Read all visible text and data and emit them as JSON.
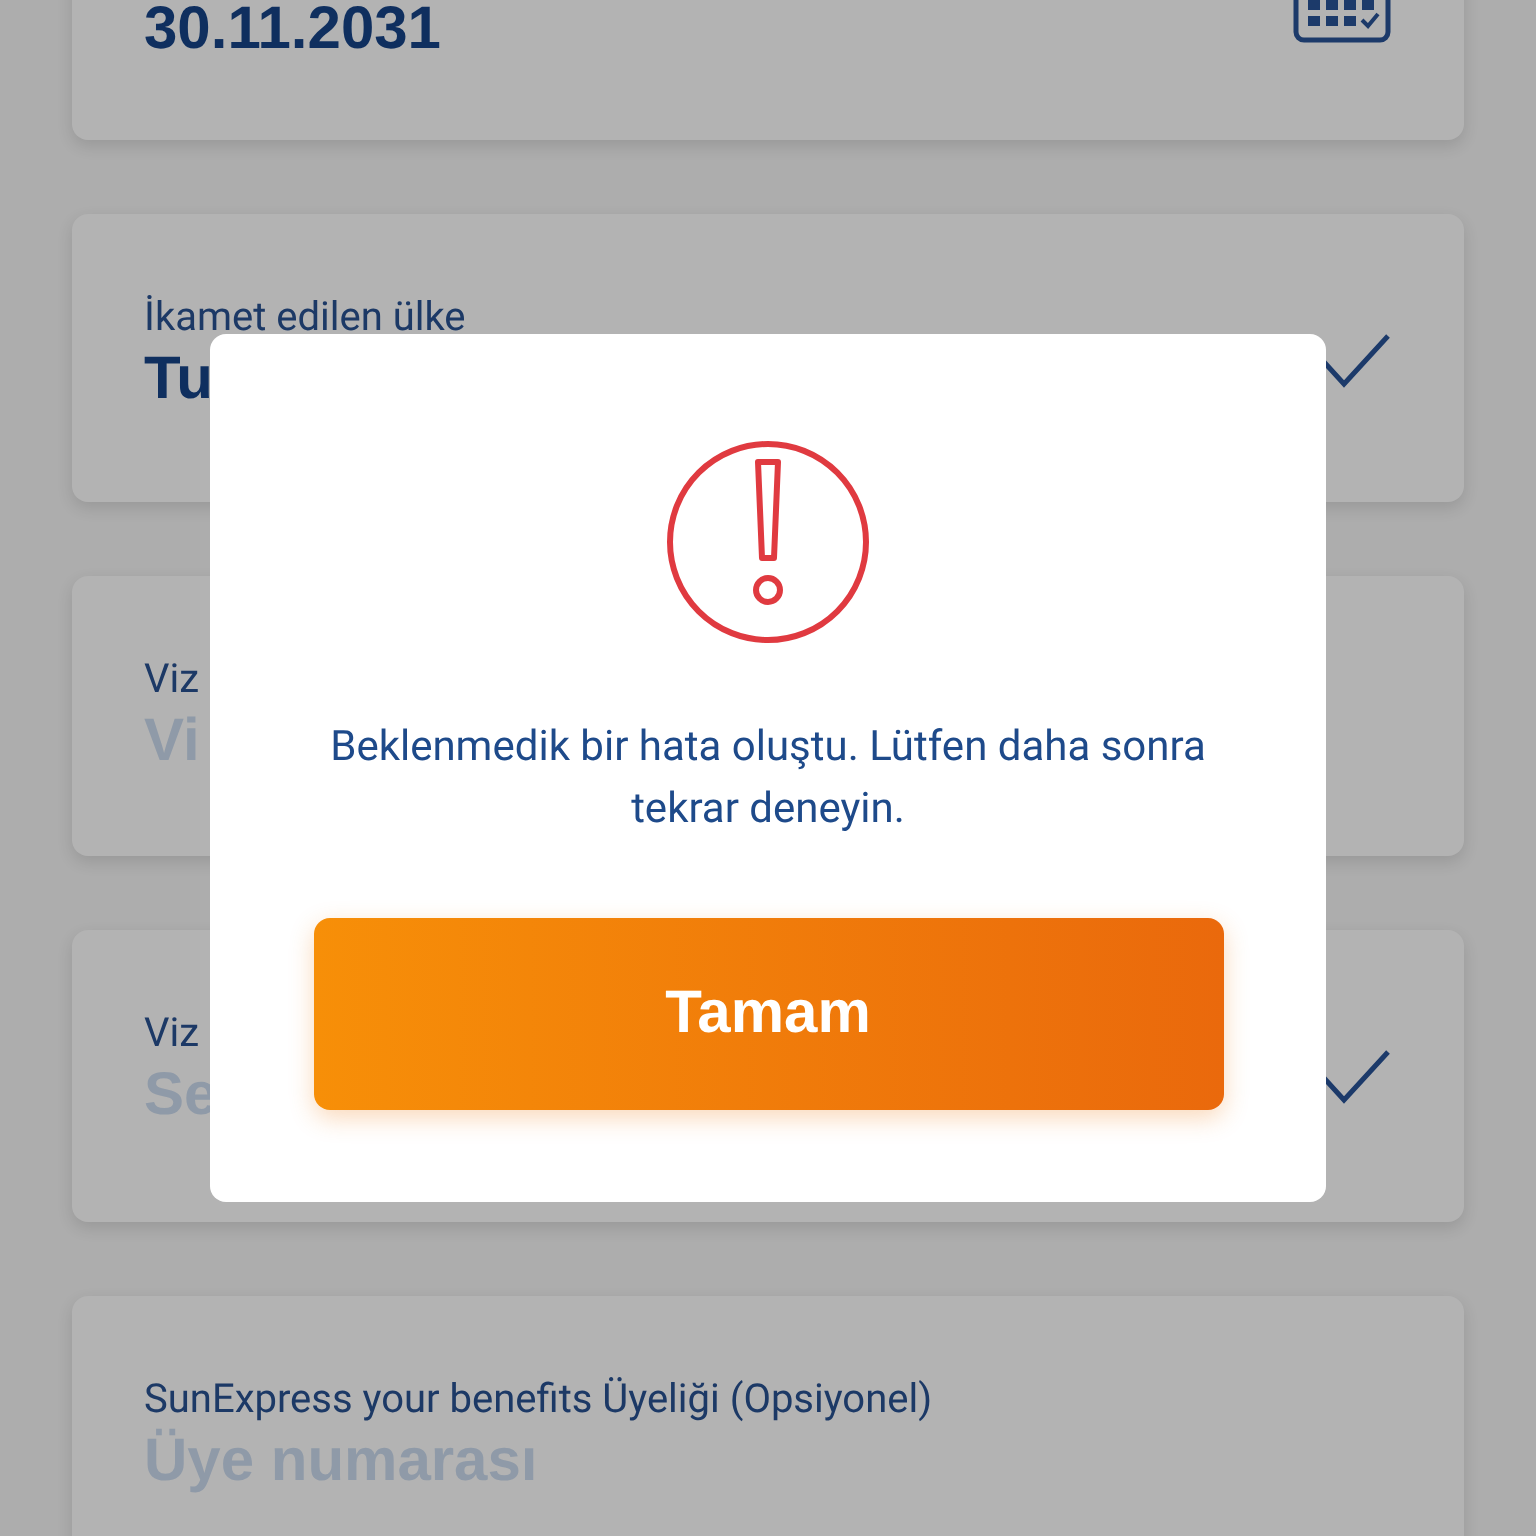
{
  "form": {
    "fields": [
      {
        "kind": "date",
        "value": "30.11.2031"
      },
      {
        "kind": "select",
        "label": "İkamet edilen ülke",
        "value": "Tu",
        "valid": true
      },
      {
        "kind": "select",
        "label": "Viz",
        "placeholder": "Vi",
        "valid": false
      },
      {
        "kind": "select",
        "label": "Viz",
        "placeholder": "Se",
        "valid": true
      },
      {
        "kind": "text",
        "label": "SunExpress your benefits Üyeliği (Opsiyonel)",
        "placeholder": "Üye numarası"
      }
    ]
  },
  "dialog": {
    "message": "Beklenmedik bir hata oluştu. Lütfen daha sonra tekrar deneyin.",
    "button": "Tamam"
  }
}
